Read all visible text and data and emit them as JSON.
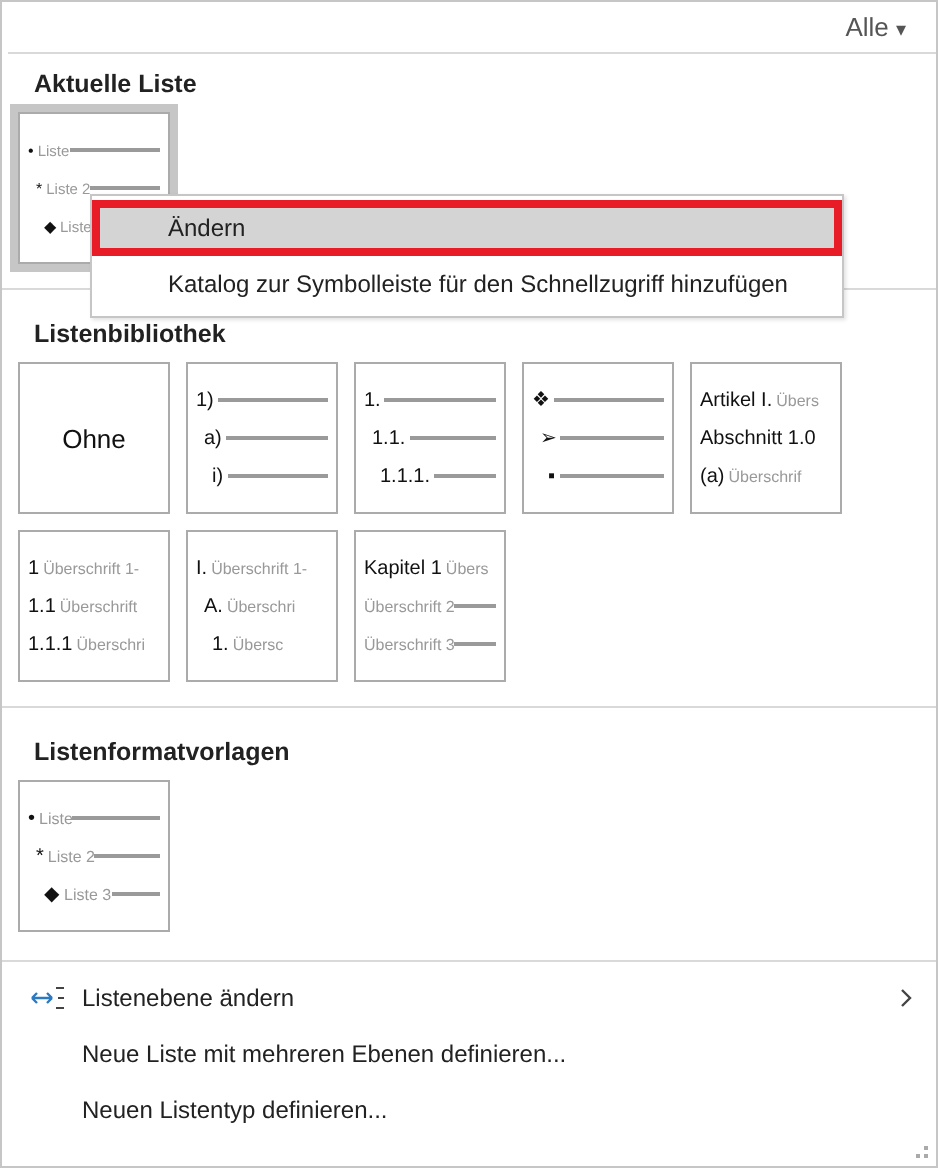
{
  "filter": {
    "label": "Alle",
    "caret": "▾"
  },
  "sections": [
    {
      "title": "Aktuelle Liste",
      "items": [
        {
          "kind": "bullet",
          "selected": true,
          "lines": [
            {
              "marker": "•",
              "text": "Liste",
              "rule": true
            },
            {
              "marker": "*",
              "text": "Liste 2",
              "rule": true
            },
            {
              "marker": "◆",
              "text": "Liste",
              "rule": false
            }
          ]
        }
      ]
    },
    {
      "title": "Listenbibliothek",
      "items": [
        {
          "kind": "none",
          "selected": false,
          "label": "Ohne"
        },
        {
          "kind": "bullet",
          "selected": false,
          "lines": [
            {
              "marker": "1)",
              "rule": true
            },
            {
              "marker": "a)",
              "rule": true
            },
            {
              "marker": "i)",
              "rule": true
            }
          ]
        },
        {
          "kind": "bullet",
          "selected": false,
          "lines": [
            {
              "marker": "1.",
              "rule": true
            },
            {
              "marker": "1.1.",
              "rule": true
            },
            {
              "marker": "1.1.1.",
              "rule": true
            }
          ]
        },
        {
          "kind": "bullet",
          "selected": false,
          "lines": [
            {
              "marker": "❖",
              "rule": true
            },
            {
              "marker": "➢",
              "rule": true
            },
            {
              "marker": "▪",
              "rule": true
            }
          ]
        },
        {
          "kind": "flat",
          "selected": false,
          "lines": [
            {
              "marker": "Artikel I.",
              "text": "Übers",
              "rule": false
            },
            {
              "marker": "Abschnitt 1.0",
              "rule": false
            },
            {
              "marker": "(a)",
              "text": "Überschrif",
              "rule": false
            }
          ]
        },
        {
          "kind": "flat",
          "selected": false,
          "lines": [
            {
              "marker": "1",
              "text": "Überschrift 1-",
              "rule": false
            },
            {
              "marker": "1.1",
              "text": "Überschrift",
              "rule": false
            },
            {
              "marker": "1.1.1",
              "text": "Überschri",
              "rule": false
            }
          ]
        },
        {
          "kind": "bullet",
          "selected": false,
          "lines": [
            {
              "marker": "I.",
              "text": "Überschrift 1-",
              "rule": false
            },
            {
              "marker": "A.",
              "text": "Überschri",
              "rule": false
            },
            {
              "marker": "1.",
              "text": "Übersc",
              "rule": false
            }
          ]
        },
        {
          "kind": "flat",
          "selected": false,
          "lines": [
            {
              "marker": "Kapitel 1",
              "text": "Übers",
              "rule": false
            },
            {
              "text": "Überschrift 2",
              "rule": true
            },
            {
              "text": "Überschrift 3",
              "rule": true
            }
          ]
        }
      ]
    },
    {
      "title": "Listenformatvorlagen",
      "items": [
        {
          "kind": "bullet",
          "selected": false,
          "lines": [
            {
              "marker": "•",
              "text": "Liste",
              "rule": true
            },
            {
              "marker": "*",
              "text": "Liste 2",
              "rule": true
            },
            {
              "marker": "◆",
              "text": "Liste 3",
              "rule": true
            }
          ]
        }
      ]
    }
  ],
  "context_menu": [
    {
      "label": "Ändern",
      "highlighted": true
    },
    {
      "label": "Katalog zur Symbolleiste für den Schnellzugriff hinzufügen",
      "highlighted": false
    }
  ],
  "commands": [
    {
      "label": "Listenebene ändern",
      "icon": true,
      "submenu": true
    },
    {
      "label": "Neue Liste mit mehreren Ebenen definieren...",
      "icon": false,
      "submenu": false
    },
    {
      "label": "Neuen Listentyp definieren...",
      "icon": false,
      "submenu": false
    }
  ]
}
